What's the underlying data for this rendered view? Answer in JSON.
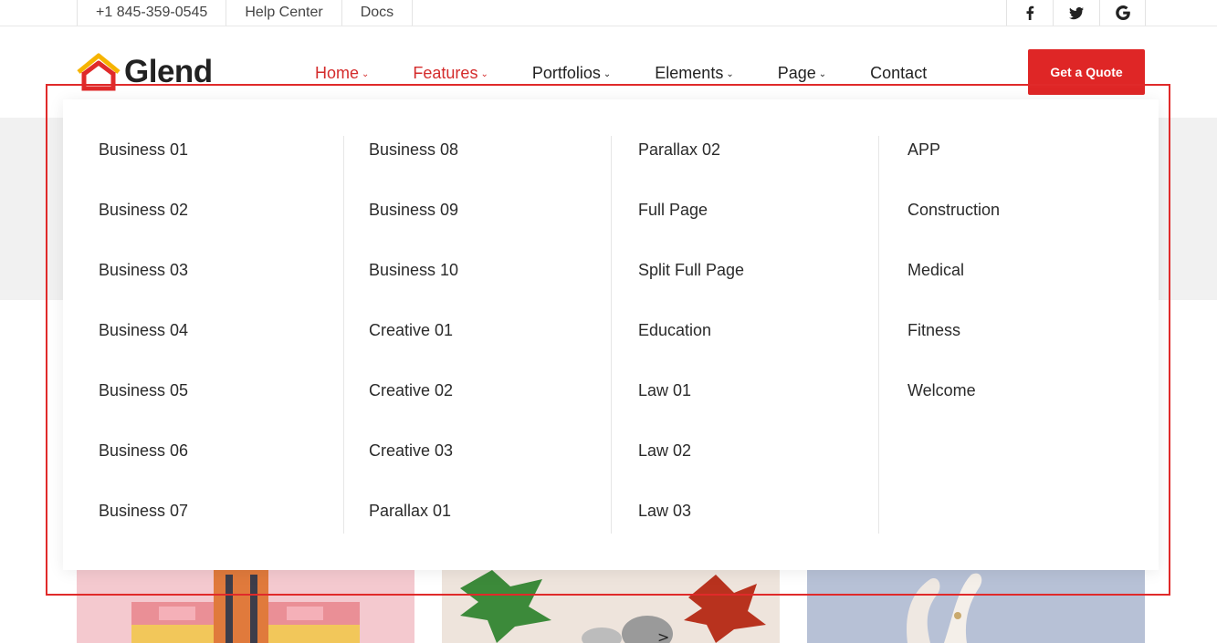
{
  "topbar": {
    "phone": "+1 845-359-0545",
    "help": "Help Center",
    "docs": "Docs"
  },
  "header": {
    "logo_text": "Glend",
    "quote_button": "Get a Quote"
  },
  "nav": [
    {
      "label": "Home",
      "active": true
    },
    {
      "label": "Features",
      "active": true
    },
    {
      "label": "Portfolios",
      "active": false
    },
    {
      "label": "Elements",
      "active": false
    },
    {
      "label": "Page",
      "active": false
    },
    {
      "label": "Contact",
      "active": false
    }
  ],
  "menu": {
    "col1": [
      "Business 01",
      "Business 02",
      "Business 03",
      "Business 04",
      "Business 05",
      "Business 06",
      "Business 07"
    ],
    "col2": [
      "Business 08",
      "Business 09",
      "Business 10",
      "Creative 01",
      "Creative 02",
      "Creative 03",
      "Parallax 01"
    ],
    "col3": [
      "Parallax 02",
      "Full Page",
      "Split Full Page",
      "Education",
      "Law 01",
      "Law 02",
      "Law 03"
    ],
    "col4": [
      "APP",
      "Construction",
      "Medical",
      "Fitness",
      "Welcome"
    ]
  },
  "colors": {
    "accent": "#df2626",
    "active_nav": "#d42b2b",
    "highlight_box": "#e02a2a"
  }
}
